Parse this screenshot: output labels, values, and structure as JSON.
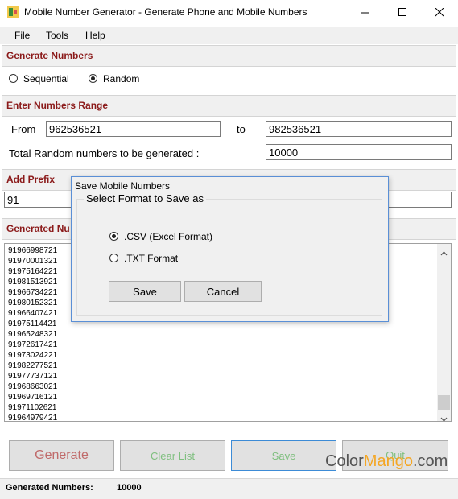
{
  "window": {
    "title": "Mobile Number Generator - Generate Phone and Mobile Numbers",
    "icon": "app-icon",
    "controls": [
      "minimize-icon",
      "maximize-icon",
      "close-icon"
    ]
  },
  "menu": {
    "file": "File",
    "tools": "Tools",
    "help": "Help"
  },
  "generate_numbers": {
    "title": "Generate Numbers",
    "sequential_label": "Sequential",
    "random_label": "Random",
    "selected": "Random"
  },
  "range": {
    "title": "Enter Numbers Range",
    "from_label": "From",
    "from_value": "962536521",
    "to_label": "to",
    "to_value": "982536521",
    "total_label": "Total Random numbers to be generated :",
    "total_value": "10000"
  },
  "prefix": {
    "title": "Add Prefix",
    "value": "91"
  },
  "generated": {
    "title": "Generated Numbers",
    "title_visible": "Generated Nu",
    "numbers": [
      "91966998721",
      "91970001321",
      "91975164221",
      "91981513921",
      "91966734221",
      "91980152321",
      "91966407421",
      "91975114421",
      "91965248321",
      "91972617421",
      "91973024221",
      "91982277521",
      "91977737121",
      "91968663021",
      "91969716121",
      "91971102621",
      "91964979421"
    ]
  },
  "buttons": {
    "generate": "Generate",
    "clear_list": "Clear List",
    "save": "Save",
    "quit": "Quit"
  },
  "status": {
    "label": "Generated Numbers:",
    "value": "10000"
  },
  "dialog": {
    "title": "Save Mobile Numbers",
    "group_label": "Select Format to Save as",
    "option_csv": ".CSV (Excel Format)",
    "option_txt": ".TXT Format",
    "selected": ".CSV (Excel Format)",
    "save_button": "Save",
    "cancel_button": "Cancel"
  },
  "watermark": {
    "part1": "Color",
    "part2": "Mango",
    "part3": ".com"
  },
  "colors": {
    "section_title": "#8b1a1a",
    "dialog_border": "#5a8fd6",
    "watermark_orange": "#f5a623",
    "watermark_gray": "#555555"
  }
}
